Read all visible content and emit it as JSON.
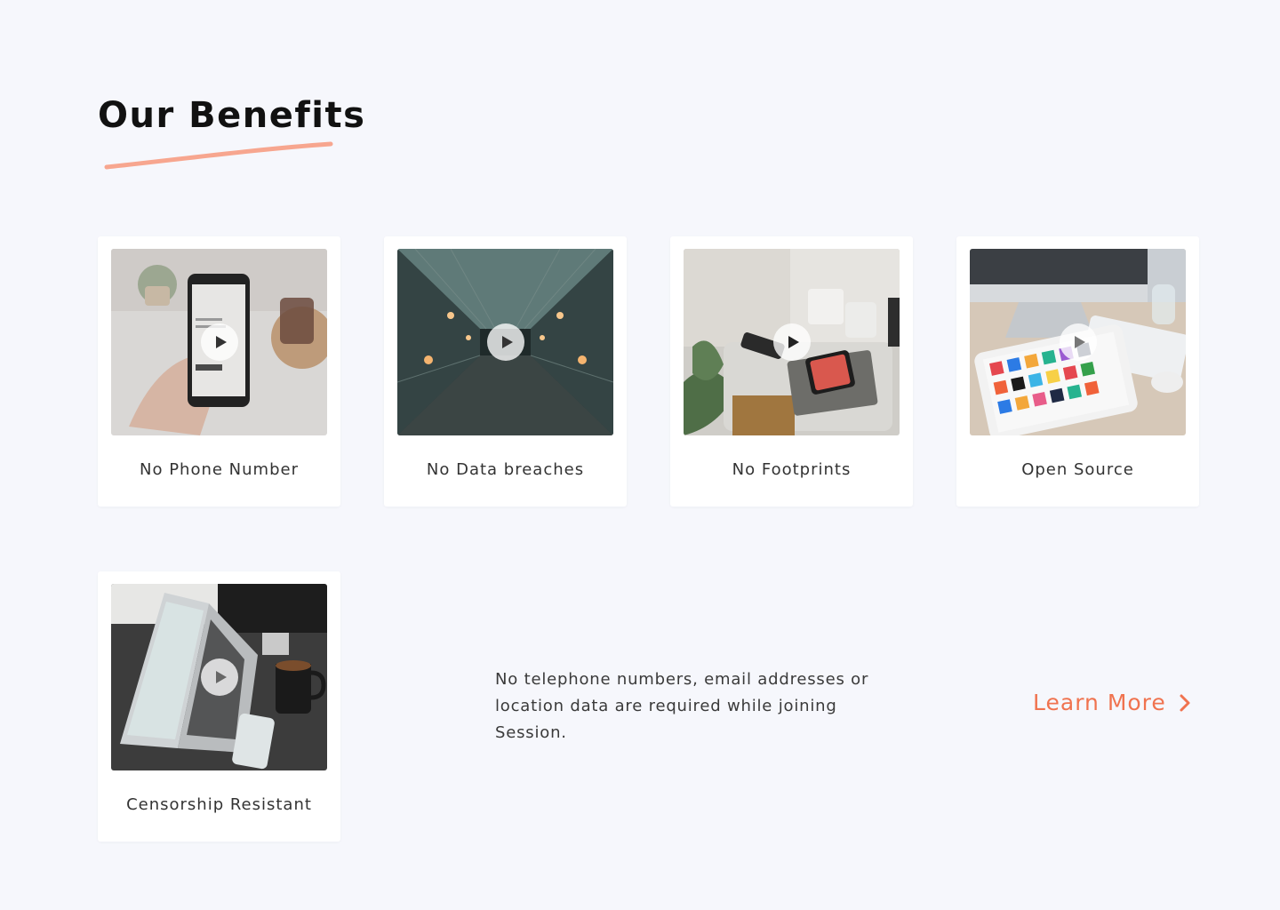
{
  "section": {
    "title": "Our Benefits",
    "accent_color": "#f7a68f"
  },
  "cards": [
    {
      "label": "No Phone Number",
      "image_icon": "phone-in-hand-image",
      "play_icon": "play-icon"
    },
    {
      "label": "No Data breaches",
      "image_icon": "server-corridor-image",
      "play_icon": "play-icon"
    },
    {
      "label": "No Footprints",
      "image_icon": "desk-phone-mug-image",
      "play_icon": "play-icon"
    },
    {
      "label": "Open Source",
      "image_icon": "tablet-apps-image",
      "play_icon": "play-icon"
    },
    {
      "label": "Censorship Resistant",
      "image_icon": "laptop-desk-image",
      "play_icon": "play-icon"
    }
  ],
  "description": "No telephone numbers, email addresses or location data are required while joining Session.",
  "cta": {
    "label": "Learn More",
    "icon": "chevron-right-icon",
    "color": "#f0734f"
  }
}
